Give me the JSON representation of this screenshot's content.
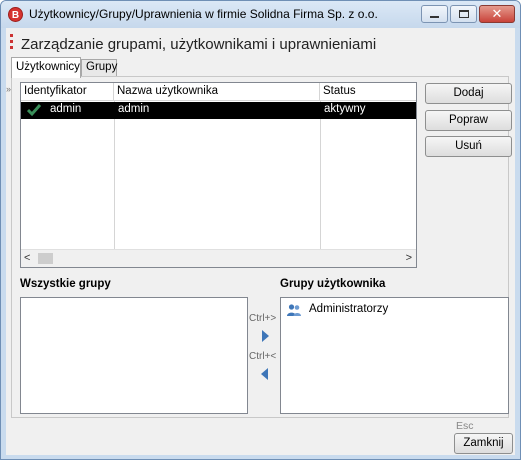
{
  "window": {
    "app_icon": "B",
    "title": "Użytkownicy/Grupy/Uprawnienia w firmie Solidna Firma Sp. z o.o.",
    "close_glyph": "✕"
  },
  "header": {
    "title": "Zarządzanie grupami, użytkownikami i uprawnieniami"
  },
  "tabs": [
    {
      "label": "Użytkownicy",
      "active": true
    },
    {
      "label": "Grupy",
      "active": false
    }
  ],
  "users_table": {
    "columns": [
      "Identyfikator",
      "Nazwa użytkownika",
      "Status"
    ],
    "rows": [
      {
        "id": "admin",
        "name": "admin",
        "status": "aktywny",
        "checked": true,
        "selected": true
      }
    ]
  },
  "actions": {
    "add": "Dodaj",
    "edit": "Popraw",
    "delete": "Usuń"
  },
  "groups": {
    "all_label": "Wszystkie grupy",
    "user_label": "Grupy użytkownika",
    "all_items": [],
    "user_items": [
      {
        "label": "Administratorzy",
        "icon": "user-group-icon"
      }
    ],
    "add_hint": "Ctrl+>",
    "remove_hint": "Ctrl+<"
  },
  "footer": {
    "esc_hint": "Esc",
    "close": "Zamknij"
  },
  "colors": {
    "accent": "#3e76b8",
    "check": "#3a8f5a",
    "selection": "#000000"
  }
}
